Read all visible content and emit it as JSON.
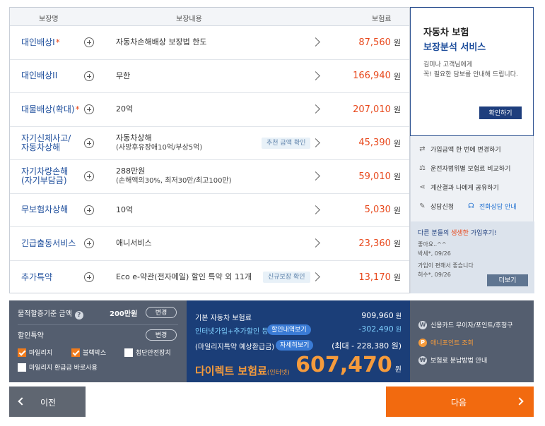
{
  "table": {
    "headers": {
      "name": "보장명",
      "content": "보장내용",
      "premium": "보험료"
    },
    "rows": [
      {
        "name": "대인배상I",
        "req": "*",
        "content": "자동차손해배상 보장법 한도",
        "sub": "",
        "tag": "",
        "price": "87,560",
        "unit": "원"
      },
      {
        "name": "대인배상II",
        "req": "",
        "content": "무한",
        "sub": "",
        "tag": "",
        "price": "166,940",
        "unit": "원"
      },
      {
        "name": "대물배상(확대)",
        "req": "*",
        "content": "20억",
        "sub": "",
        "tag": "",
        "price": "207,010",
        "unit": "원"
      },
      {
        "name": "자기신체사고/",
        "name2": "자동차상해",
        "req": "",
        "content": "자동차상해",
        "sub": "(사망후유장애10억/부상5억)",
        "tag": "추천 금액 확인",
        "price": "45,390",
        "unit": "원"
      },
      {
        "name": "자기차량손해",
        "name2": "(자기부담금)",
        "req": "",
        "content": "288만원",
        "sub": "(손해액의30%, 최저30만/최고100만)",
        "tag": "",
        "price": "59,010",
        "unit": "원"
      },
      {
        "name": "무보험차상해",
        "req": "",
        "content": "10억",
        "sub": "",
        "tag": "",
        "price": "5,030",
        "unit": "원"
      },
      {
        "name": "긴급출동서비스",
        "req": "",
        "content": "애니서비스",
        "sub": "",
        "tag": "",
        "price": "23,360",
        "unit": "원"
      },
      {
        "name": "추가특약",
        "req": "",
        "content": "Eco e-약관(전자메일) 할인 특약 외 11개",
        "sub": "",
        "tag": "신규보장 확인",
        "price": "13,170",
        "unit": "원"
      }
    ]
  },
  "promo": {
    "title1": "자동차 보험",
    "title2": "보장분석 서비스",
    "desc1": "김미나 고객님에게",
    "desc2": "꼭! 필요한 담보를 안내해 드립니다.",
    "button": "확인하기"
  },
  "side": {
    "menu": [
      {
        "label": "가입금액 한 번에 변경하기",
        "icon": "shuffle-icon"
      },
      {
        "label": "운전자범위별 보험료 비교하기",
        "icon": "balance-icon"
      },
      {
        "label": "계산결과 나에게 공유하기",
        "icon": "share-icon"
      },
      {
        "label": "상담신청",
        "icon": "edit-icon"
      },
      {
        "label": "전화상담 안내",
        "icon": "headset-icon"
      }
    ],
    "review": {
      "heading_pre": "다른 분들의 ",
      "heading_em": "생생한",
      "heading_post": " 가입후기!",
      "r1": "좋아요..^^",
      "r1_by": "박세*, 09/26",
      "r2": "가입이 편해서 좋습니다",
      "r2_by": "허수*, 09/26",
      "more": "더보기"
    }
  },
  "bottom_left": {
    "mileage_label": "물적할증기준 금액",
    "mileage_amount": "200만원",
    "change1": "변경",
    "discount_label": "할인특약",
    "change2": "변경",
    "checks": [
      {
        "label": "마일리지",
        "checked": true
      },
      {
        "label": "블랙박스",
        "checked": true
      },
      {
        "label": "첨단안전장치",
        "checked": false
      },
      {
        "label": "마일리지 환급금 바로사용",
        "checked": false
      }
    ]
  },
  "bottom_mid": {
    "base_label": "기본 자동차 보험료",
    "base_value": "909,960",
    "disc_label": "인터넷가입+추가할인 등",
    "disc_pill": "할인내역보기",
    "disc_value": "-302,490",
    "mile_label": "(마일리지특약 예상환급금)",
    "mile_pill": "자세히보기",
    "mile_value": "(최대 - 228,380 원)",
    "unit": "원",
    "direct_label": "다이렉트 보험료",
    "direct_sub": "(인터넷)",
    "direct_value": "607,470"
  },
  "bottom_right": {
    "items": [
      {
        "label": "신용카드 무이자/포인트/후청구",
        "icon": "card-icon"
      },
      {
        "label": "애니포인트 조회",
        "icon": "point-icon"
      },
      {
        "label": "보험료 분납방법 안내",
        "icon": "installment-icon"
      }
    ]
  },
  "nav": {
    "prev": "이전",
    "next": "다음"
  }
}
